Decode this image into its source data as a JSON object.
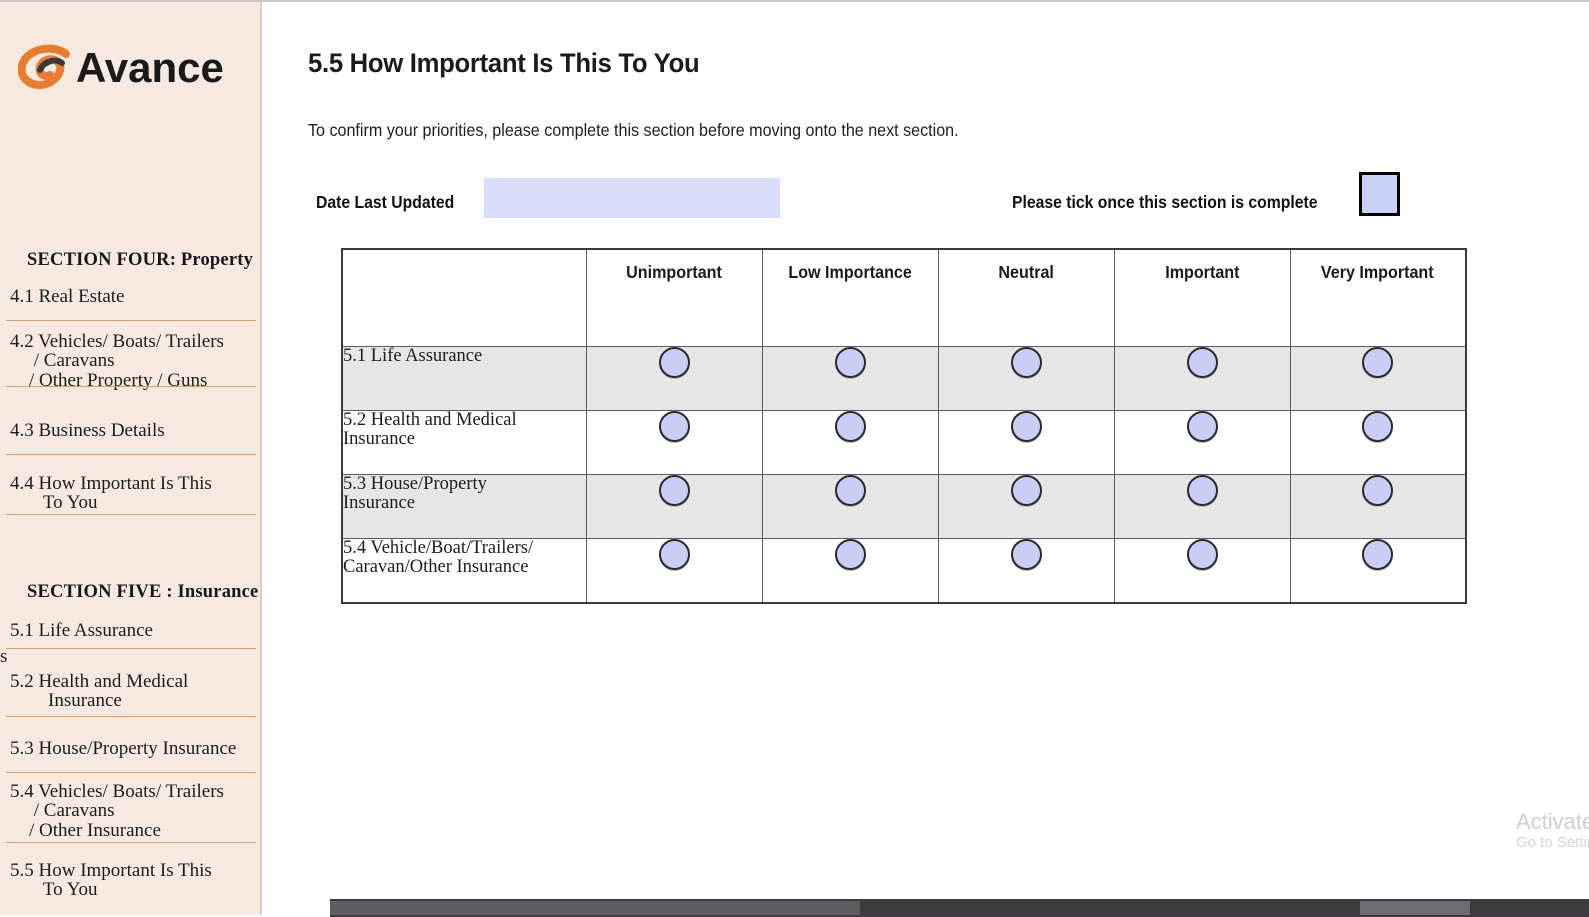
{
  "brand": {
    "name": "Avance",
    "logo_icon": "swoosh-icon",
    "accent_color": "#ea7c2e"
  },
  "sidebar": {
    "background_color": "#f6e9df",
    "divider_color": "#e79a55",
    "stray_char": "s",
    "sections": [
      {
        "title": "SECTION FOUR: Property",
        "items": [
          "4.1 Real Estate",
          "4.2 Vehicles/ Boats/ Trailers\n     / Caravans\n    / Other Property / Guns",
          "4.3 Business Details",
          "4.4 How Important Is This\n       To You"
        ]
      },
      {
        "title": "SECTION FIVE : Insurance",
        "items": [
          "5.1 Life Assurance",
          "5.2 Health and Medical\n        Insurance",
          "5.3 House/Property Insurance",
          "5.4 Vehicles/ Boats/ Trailers\n     / Caravans\n    / Other Insurance",
          "5.5 How Important Is This\n       To You"
        ]
      }
    ]
  },
  "main": {
    "title": "5.5 How Important Is This To You",
    "intro": "To confirm your priorities, please complete this section before moving onto the next section.",
    "date_label": "Date Last Updated",
    "date_value": "",
    "date_placeholder": "",
    "date_field_color": "#dbdefa",
    "tick_label": "Please tick once this section is complete",
    "checkbox_checked": false,
    "checkbox_fill": "#c9d2f6"
  },
  "matrix": {
    "row_header": "",
    "columns": [
      "Unimportant",
      "Low Importance",
      "Neutral",
      "Important",
      "Very Important"
    ],
    "rows": [
      {
        "label": "5.1 Life Assurance",
        "selected": null
      },
      {
        "label": "5.2 Health and Medical\nInsurance",
        "selected": null
      },
      {
        "label": "5.3 House/Property\nInsurance",
        "selected": null
      },
      {
        "label": "5.4 Vehicle/Boat/Trailers/\nCaravan/Other Insurance",
        "selected": null
      }
    ],
    "radio_fill": "#c8cef5",
    "shaded_row_color": "#e6e6e6"
  },
  "watermark": {
    "line1": "Activate Windows",
    "line2": "Go to Settings to activate Windows."
  }
}
